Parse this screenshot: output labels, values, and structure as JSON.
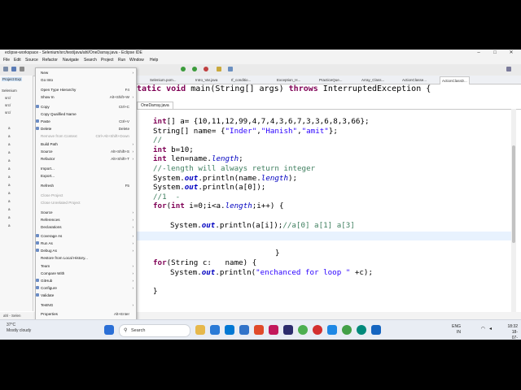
{
  "window": {
    "title": "eclipse-workspace - Selenium/src/test/java/ahl/OneDarray.java - Eclipse IDE"
  },
  "menubar": [
    "File",
    "Edit",
    "Source",
    "Refactor",
    "Navigate",
    "Search",
    "Project",
    "Run",
    "Window",
    "Help"
  ],
  "left_panel": {
    "title": "Project Exp",
    "rows": [
      "Selenium",
      "src/",
      "src/",
      "src/",
      "a",
      "a",
      "a",
      "a",
      "a",
      "a",
      "a",
      "a",
      "a",
      "a",
      "a",
      "a",
      "a",
      "src/",
      "JRE",
      "Mav",
      "TestNG",
      "src/"
    ]
  },
  "editor_tabs": [
    "Selenium.pom...",
    "Intro_Var.java",
    "If_conditio...",
    "Exception_H...",
    "PracticeQue...",
    "Array_Class...",
    "ActionClasse...",
    "ActionClassD..."
  ],
  "file_tab": "OneDarray.java",
  "signature": {
    "kw": "tatic void",
    "rest": " main(String[] args) ",
    "throws": "throws",
    "exc": " InterruptedException {"
  },
  "code": {
    "l1_kw": "int",
    "l1_rest": "[] a= {10,11,12,99,4,7,4,3,6,7,3,3,6,8,3,66};",
    "l2_a": "String[] name= {",
    "l2_s1": "\"Inder\"",
    "l2_c1": ",",
    "l2_s2": "\"Hanish\"",
    "l2_c2": ",",
    "l2_s3": "\"amit\"",
    "l2_end": "};",
    "l3": "//",
    "l4_kw": "int",
    "l4_rest": " b=10;",
    "l5_kw": "int",
    "l5_rest": " len=name.",
    "l5_field": "length",
    "l5_end": ";",
    "l6": "//-length will always return integer",
    "l7_a": "System.",
    "l7_out": "out",
    "l7_b": ".println(name.",
    "l7_field": "length",
    "l7_c": ");",
    "l8_a": "System.",
    "l8_out": "out",
    "l8_b": ".println(a[0]);",
    "l9": "//1  -",
    "l10_for": "for",
    "l10_b": "(",
    "l10_int": "int",
    "l10_c": " i=0;i<a.",
    "l10_field": "length",
    "l10_d": ";i++) {",
    "l11_a": "System.",
    "l11_out": "out",
    "l11_b": ".println(a[i]);",
    "l11_cm": "//a[0] a[1] a[3]",
    "l12": "}",
    "l13_for": "for",
    "l13_b": "(String c:   name) {",
    "l14_a": "System.",
    "l14_out": "out",
    "l14_b": ".println(",
    "l14_str": "\"enchanced for loop \"",
    "l14_c": " +c);",
    "l15": "}"
  },
  "context_menu": [
    {
      "label": "New",
      "shortcut": "",
      "arrow": true,
      "disabled": false
    },
    {
      "label": "Go Into",
      "shortcut": "",
      "arrow": false,
      "disabled": false
    },
    {
      "label": "Open Type Hierarchy",
      "shortcut": "F4",
      "arrow": false,
      "disabled": false
    },
    {
      "label": "Show In",
      "shortcut": "Alt+Shift+W",
      "arrow": true,
      "disabled": false
    },
    {
      "label": "Copy",
      "shortcut": "Ctrl+C",
      "arrow": false,
      "disabled": false
    },
    {
      "label": "Copy Qualified Name",
      "shortcut": "",
      "arrow": false,
      "disabled": false
    },
    {
      "label": "Paste",
      "shortcut": "Ctrl+V",
      "arrow": false,
      "disabled": false
    },
    {
      "label": "Delete",
      "shortcut": "Delete",
      "arrow": false,
      "disabled": false
    },
    {
      "label": "Remove from Context",
      "shortcut": "Ctrl+Alt+Shift+Down",
      "arrow": false,
      "disabled": true
    },
    {
      "label": "Build Path",
      "shortcut": "",
      "arrow": true,
      "disabled": false
    },
    {
      "label": "Source",
      "shortcut": "Alt+Shift+S",
      "arrow": true,
      "disabled": false
    },
    {
      "label": "Refactor",
      "shortcut": "Alt+Shift+T",
      "arrow": true,
      "disabled": false
    },
    {
      "label": "Import...",
      "shortcut": "",
      "arrow": false,
      "disabled": false
    },
    {
      "label": "Export...",
      "shortcut": "",
      "arrow": false,
      "disabled": false
    },
    {
      "label": "Refresh",
      "shortcut": "F5",
      "arrow": false,
      "disabled": false
    },
    {
      "label": "Close Project",
      "shortcut": "",
      "arrow": false,
      "disabled": true
    },
    {
      "label": "Close Unrelated Project",
      "shortcut": "",
      "arrow": false,
      "disabled": true
    },
    {
      "label": "Source",
      "shortcut": "",
      "arrow": true,
      "disabled": false
    },
    {
      "label": "References",
      "shortcut": "",
      "arrow": true,
      "disabled": false
    },
    {
      "label": "Declarations",
      "shortcut": "",
      "arrow": true,
      "disabled": false
    },
    {
      "label": "Coverage As",
      "shortcut": "",
      "arrow": true,
      "disabled": false
    },
    {
      "label": "Run As",
      "shortcut": "",
      "arrow": true,
      "disabled": false
    },
    {
      "label": "Debug As",
      "shortcut": "",
      "arrow": true,
      "disabled": false
    },
    {
      "label": "Restore from Local History...",
      "shortcut": "",
      "arrow": false,
      "disabled": false
    },
    {
      "label": "Team",
      "shortcut": "",
      "arrow": true,
      "disabled": false
    },
    {
      "label": "Compare With",
      "shortcut": "",
      "arrow": true,
      "disabled": false
    },
    {
      "label": "GitHub",
      "shortcut": "",
      "arrow": true,
      "disabled": false
    },
    {
      "label": "Configure",
      "shortcut": "",
      "arrow": true,
      "disabled": false
    },
    {
      "label": "Validate",
      "shortcut": "",
      "arrow": false,
      "disabled": false
    },
    {
      "label": "TestNG",
      "shortcut": "",
      "arrow": true,
      "disabled": false
    },
    {
      "label": "Properties",
      "shortcut": "Alt+Enter",
      "arrow": false,
      "disabled": false
    }
  ],
  "status_bar": "ahl - Selen",
  "taskbar": {
    "weather_temp": "37°C",
    "weather_desc": "Mostly cloudy",
    "search": "Search",
    "lang": "ENG",
    "region": "IN",
    "time": "18:32",
    "date": "18-07-2024"
  },
  "colors": {
    "keyword": "#7f0055",
    "string": "#2a00ff",
    "comment": "#3f7f5f",
    "field": "#0000c0"
  }
}
